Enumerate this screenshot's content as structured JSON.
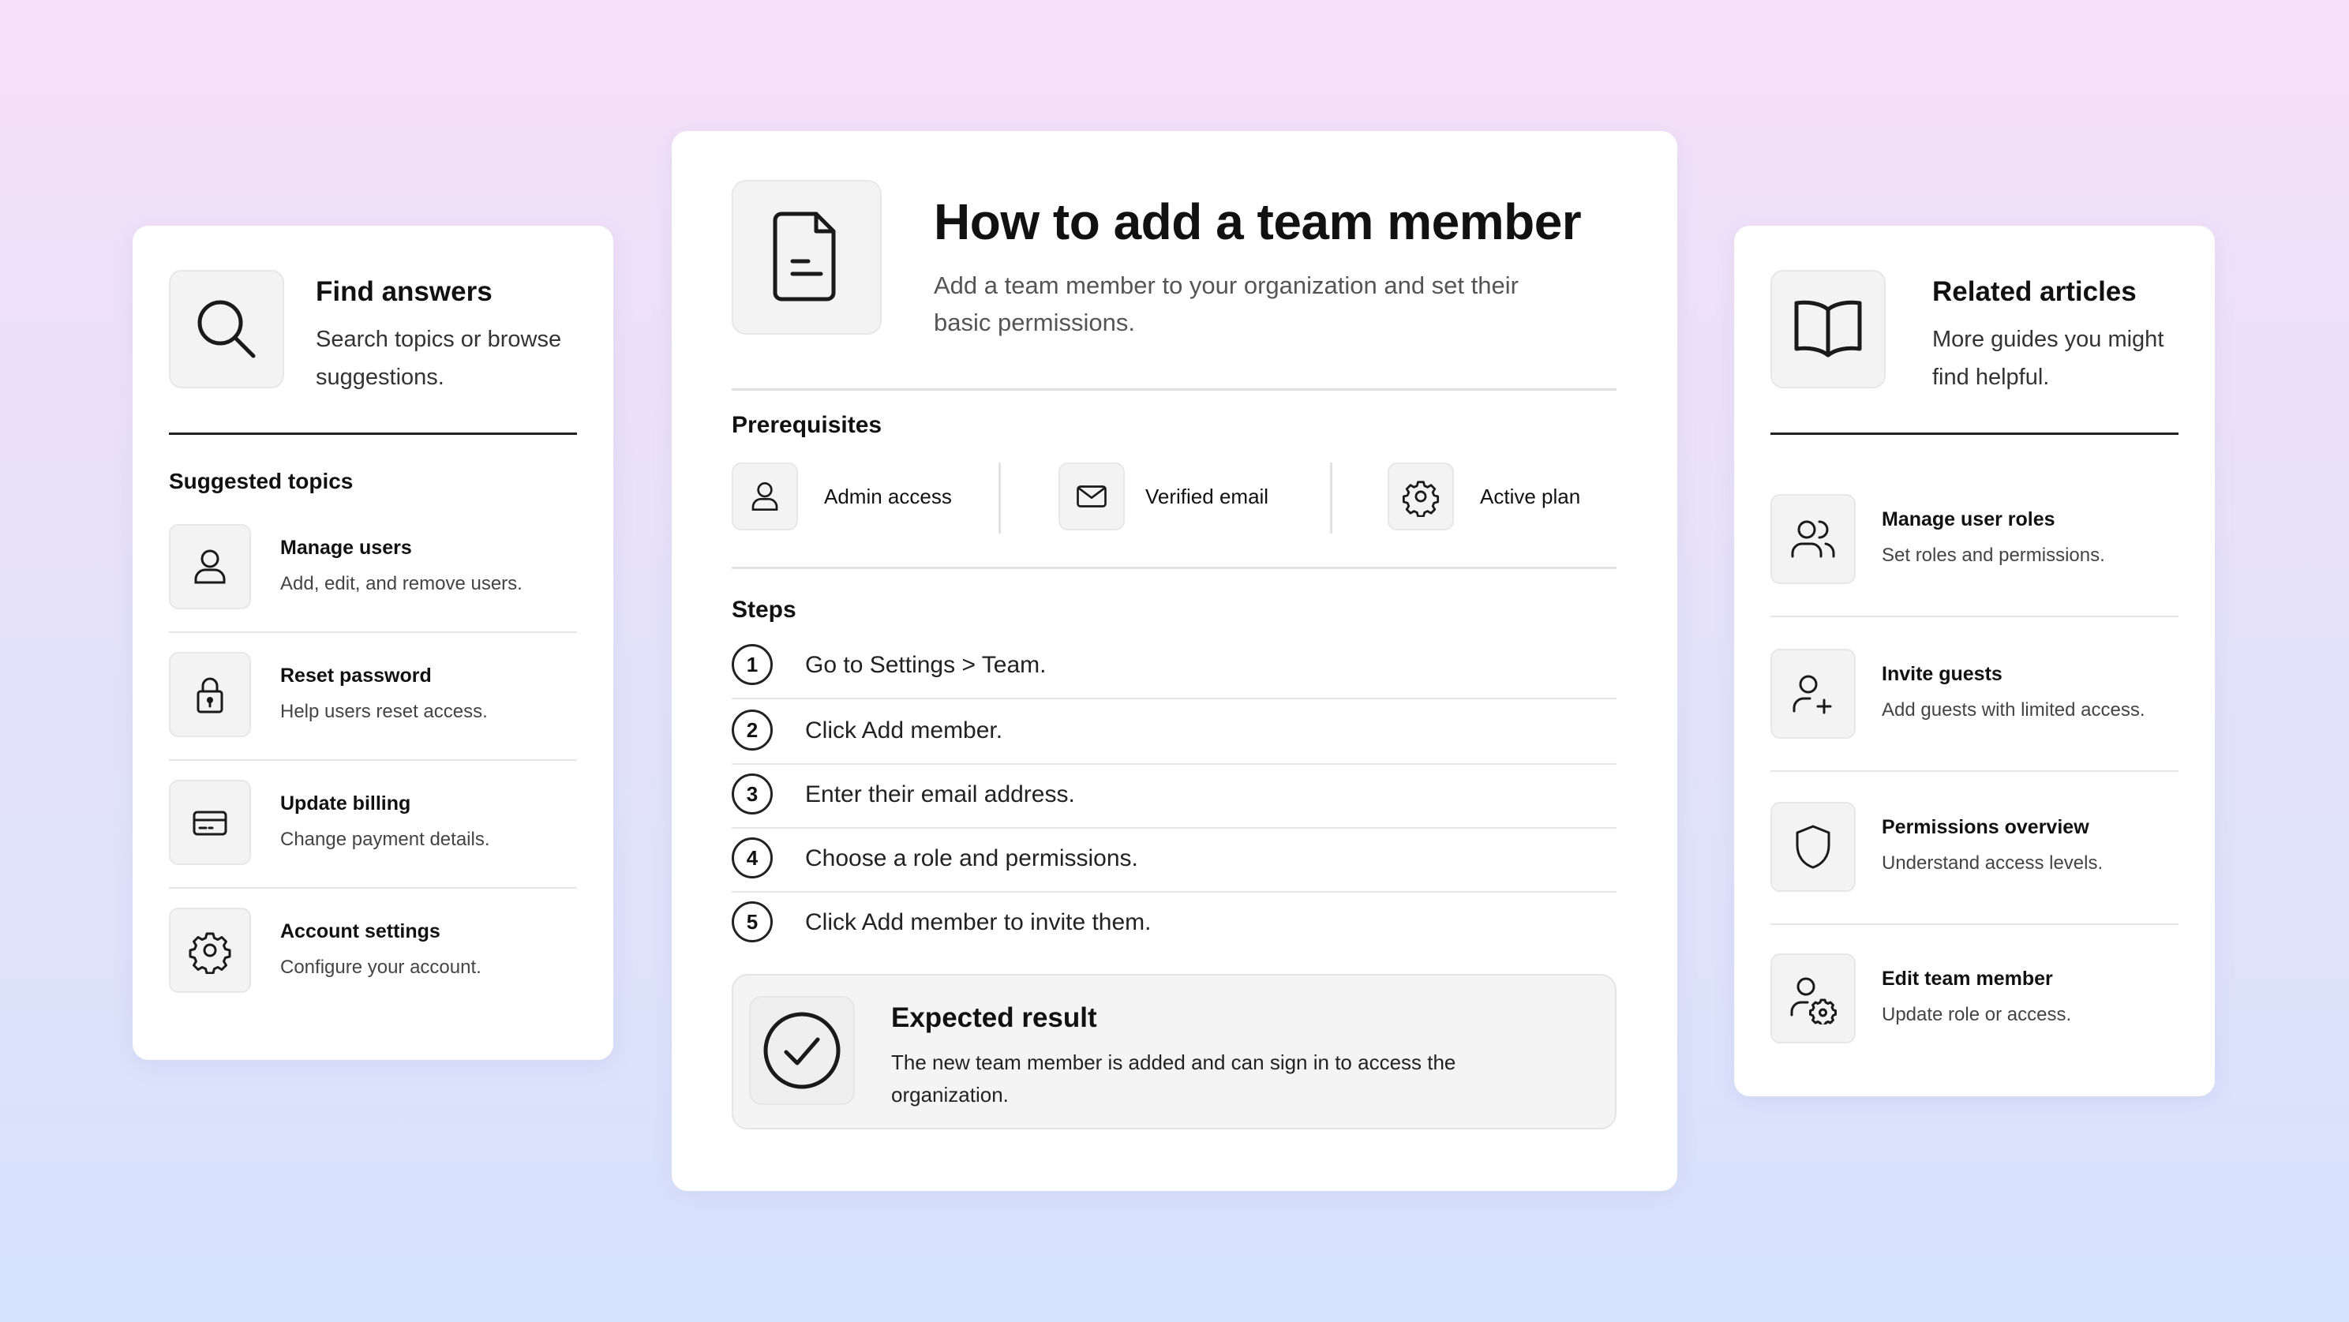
{
  "find_answers": {
    "title": "Find answers",
    "description": "Search topics or browse suggestions.",
    "icon": "search-icon",
    "section_label": "Suggested topics",
    "topics": [
      {
        "title": "Manage users",
        "description": "Add, edit, and remove users.",
        "icon": "user-icon"
      },
      {
        "title": "Reset password",
        "description": "Help users reset access.",
        "icon": "lock-icon"
      },
      {
        "title": "Update billing",
        "description": "Change payment details.",
        "icon": "credit-card-icon"
      },
      {
        "title": "Account settings",
        "description": "Configure your account.",
        "icon": "gear-icon"
      }
    ]
  },
  "article": {
    "icon": "document-icon",
    "title": "How to add a team member",
    "description": "Add a team member to your organization and set their basic permissions.",
    "prerequisites_label": "Prerequisites",
    "prerequisites": [
      {
        "label": "Admin access",
        "icon": "user-icon"
      },
      {
        "label": "Verified email",
        "icon": "mail-icon"
      },
      {
        "label": "Active plan",
        "icon": "gear-icon"
      }
    ],
    "steps_label": "Steps",
    "steps": [
      {
        "number": "1",
        "text": "Go to Settings > Team."
      },
      {
        "number": "2",
        "text": "Click Add member."
      },
      {
        "number": "3",
        "text": "Enter their email address."
      },
      {
        "number": "4",
        "text": "Choose a role and permissions."
      },
      {
        "number": "5",
        "text": "Click Add member to invite them."
      }
    ],
    "expected_result": {
      "icon": "check-circle-icon",
      "title": "Expected result",
      "description": "The new team member is added and can sign in to access the organization."
    }
  },
  "related": {
    "title": "Related articles",
    "description": "More guides you might find helpful.",
    "icon": "book-icon",
    "articles": [
      {
        "title": "Manage user roles",
        "description": "Set roles and permissions.",
        "icon": "users-icon"
      },
      {
        "title": "Invite guests",
        "description": "Add guests with limited access.",
        "icon": "user-plus-icon"
      },
      {
        "title": "Permissions overview",
        "description": "Understand access levels.",
        "icon": "shield-icon"
      },
      {
        "title": "Edit team member",
        "description": "Update role or access.",
        "icon": "user-gear-icon"
      }
    ]
  }
}
